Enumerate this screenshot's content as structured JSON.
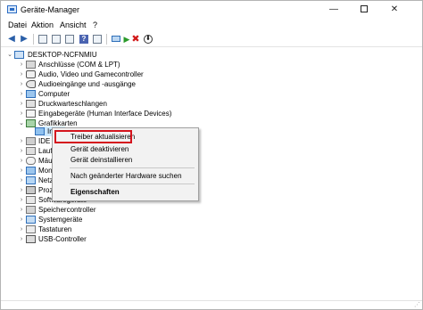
{
  "window": {
    "title": "Geräte-Manager",
    "controls": {
      "minimize": "—",
      "close": "✕"
    }
  },
  "menu": [
    "Datei",
    "Aktion",
    "Ansicht",
    "?"
  ],
  "toolbar": {
    "back": "◀",
    "forward": "▶",
    "help": "?",
    "uninstall": "✖",
    "update": "⬇",
    "scan": "▶"
  },
  "tree": {
    "root": "DESKTOP-NCFNMIU",
    "categories": [
      "Anschlüsse (COM & LPT)",
      "Audio, Video und Gamecontroller",
      "Audioeingänge und -ausgänge",
      "Computer",
      "Druckwarteschlangen",
      "Eingabegeräte (Human Interface Devices)",
      "Grafikkarten",
      "IDE A",
      "Laufw",
      "Mäus",
      "Mon",
      "Netzw",
      "Proze",
      "Softwaregeräte",
      "Speichercontroller",
      "Systemgeräte",
      "Tastaturen",
      "USB-Controller"
    ],
    "selected_item": "Int"
  },
  "context_menu": {
    "items": [
      "Treiber aktualisieren",
      "Gerät deaktivieren",
      "Gerät deinstallieren",
      "Nach geänderter Hardware suchen",
      "Eigenschaften"
    ]
  },
  "colors": {
    "highlight_border": "#d4141d",
    "selection": "#cce8ff",
    "menu_bg": "#f2f2f2"
  }
}
